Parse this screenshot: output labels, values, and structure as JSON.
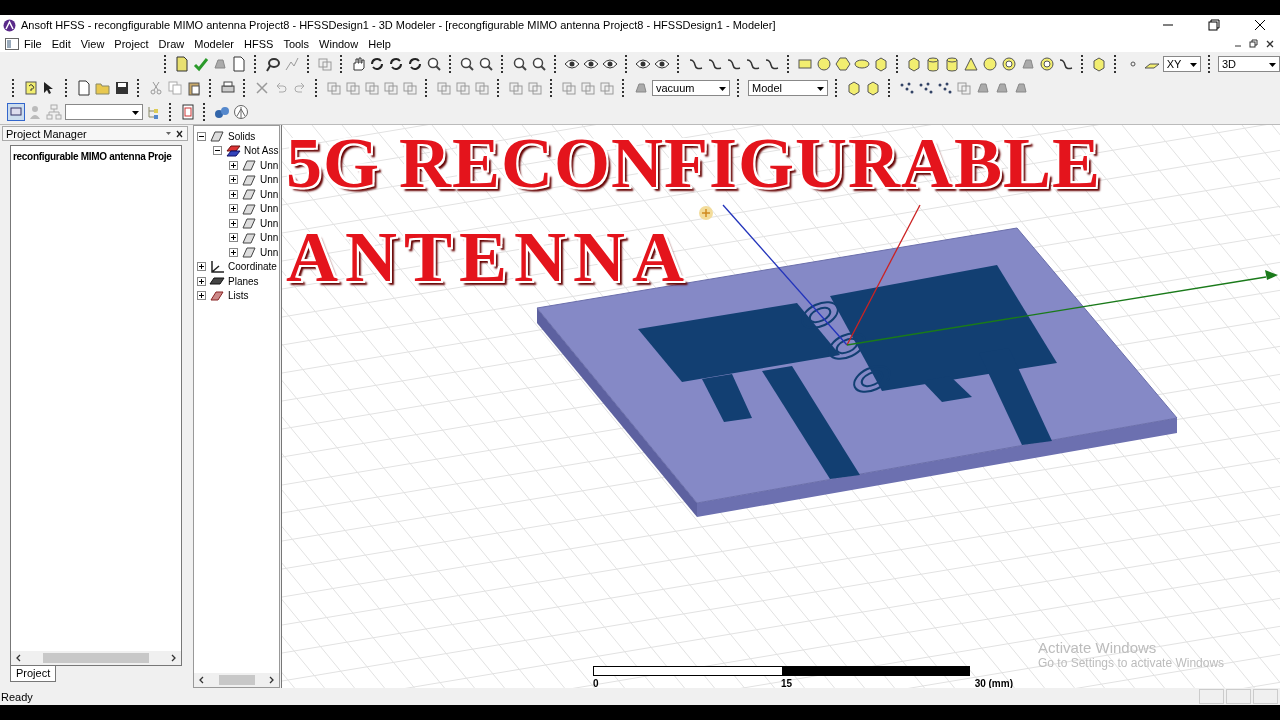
{
  "window": {
    "title": "Ansoft HFSS  - recongfigurable MIMO antenna Project8 - HFSSDesign1 - 3D Modeler - [recongfigurable MIMO antenna Project8 - HFSSDesign1 - Modeler]"
  },
  "menu": [
    "File",
    "Edit",
    "View",
    "Project",
    "Draw",
    "Modeler",
    "HFSS",
    "Tools",
    "Window",
    "Help"
  ],
  "toolbar": {
    "plane": "XY",
    "view": "3D",
    "material": "vacuum",
    "model": "Model"
  },
  "project_manager": {
    "title": "Project Manager",
    "project": "reconfigurable MIMO antenna Proje",
    "tab": "Project"
  },
  "model_tree": [
    {
      "label": "Solids",
      "kind": "solid",
      "expanded": true,
      "children": [
        {
          "label": "Not Ass",
          "kind": "material",
          "expanded": true,
          "children": [
            {
              "label": "Unn",
              "kind": "solid",
              "expanded": false
            },
            {
              "label": "Unn",
              "kind": "solid",
              "expanded": false
            },
            {
              "label": "Unn",
              "kind": "solid",
              "expanded": false
            },
            {
              "label": "Unn",
              "kind": "solid",
              "expanded": false
            },
            {
              "label": "Unn",
              "kind": "solid",
              "expanded": false
            },
            {
              "label": "Unn",
              "kind": "solid",
              "expanded": false
            },
            {
              "label": "Unn",
              "kind": "solid",
              "expanded": false
            }
          ]
        }
      ]
    },
    {
      "label": "Coordinate",
      "kind": "coordinate",
      "expanded": false
    },
    {
      "label": "Planes",
      "kind": "planes",
      "expanded": false
    },
    {
      "label": "Lists",
      "kind": "lists",
      "expanded": false
    }
  ],
  "viewport": {
    "headline": [
      "5G RECONFIGURABLE",
      "ANTENNA"
    ],
    "scale_labels": [
      "0",
      "15",
      "30 (mm)"
    ],
    "notice": {
      "title": "Activate Windows",
      "text": "Go to Settings to activate Windows"
    }
  },
  "status_bar": {
    "text": "Ready"
  }
}
